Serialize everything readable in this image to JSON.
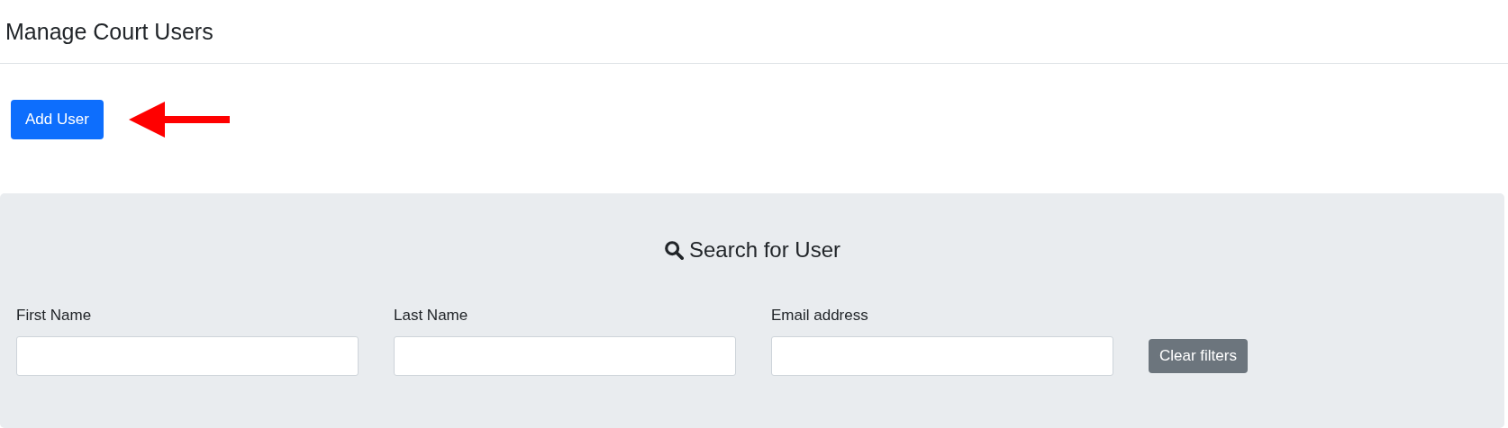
{
  "page_title": "Manage Court Users",
  "add_button": "Add User",
  "search_panel": {
    "title": "Search for User",
    "fields": [
      {
        "label": "First Name"
      },
      {
        "label": "Last Name"
      },
      {
        "label": "Email address"
      }
    ],
    "clear_button": "Clear filters"
  }
}
